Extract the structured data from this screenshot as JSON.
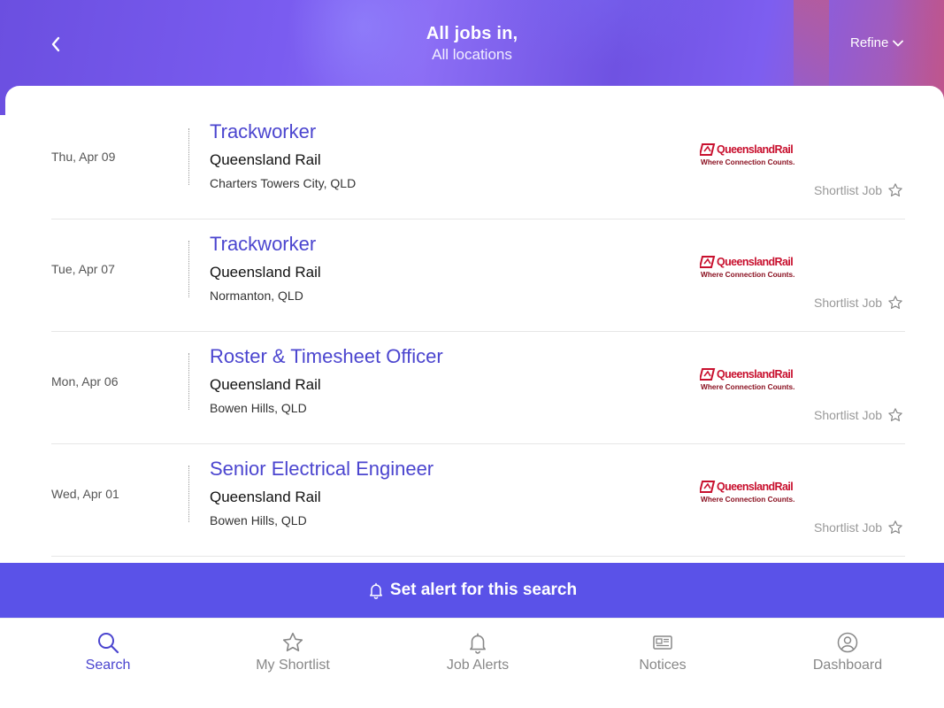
{
  "header": {
    "title": "All jobs in,",
    "subtitle": "All locations",
    "refine_label": "Refine"
  },
  "jobs": [
    {
      "date": "Thu, Apr 09",
      "title": "Trackworker",
      "company": "Queensland Rail",
      "location": "Charters Towers City, QLD",
      "logo_text": "QueenslandRail",
      "logo_tagline": "Where Connection Counts.",
      "shortlist_label": "Shortlist Job"
    },
    {
      "date": "Tue, Apr 07",
      "title": "Trackworker",
      "company": "Queensland Rail",
      "location": "Normanton, QLD",
      "logo_text": "QueenslandRail",
      "logo_tagline": "Where Connection Counts.",
      "shortlist_label": "Shortlist Job"
    },
    {
      "date": "Mon, Apr 06",
      "title": "Roster & Timesheet Officer",
      "company": "Queensland Rail",
      "location": "Bowen Hills, QLD",
      "logo_text": "QueenslandRail",
      "logo_tagline": "Where Connection Counts.",
      "shortlist_label": "Shortlist Job"
    },
    {
      "date": "Wed, Apr 01",
      "title": "Senior Electrical Engineer",
      "company": "Queensland Rail",
      "location": "Bowen Hills, QLD",
      "logo_text": "QueenslandRail",
      "logo_tagline": "Where Connection Counts.",
      "shortlist_label": "Shortlist Job"
    }
  ],
  "alert_bar": {
    "label": "Set alert for this search",
    "icon": "bell-icon"
  },
  "tabs": [
    {
      "label": "Search",
      "icon": "search-icon",
      "active": true
    },
    {
      "label": "My Shortlist",
      "icon": "star-icon",
      "active": false
    },
    {
      "label": "Job Alerts",
      "icon": "bell-icon",
      "active": false
    },
    {
      "label": "Notices",
      "icon": "newspaper-icon",
      "active": false
    },
    {
      "label": "Dashboard",
      "icon": "user-circle-icon",
      "active": false
    }
  ],
  "colors": {
    "accent": "#5a52e8",
    "link": "#4b45cf",
    "brand_logo": "#c8102e"
  }
}
